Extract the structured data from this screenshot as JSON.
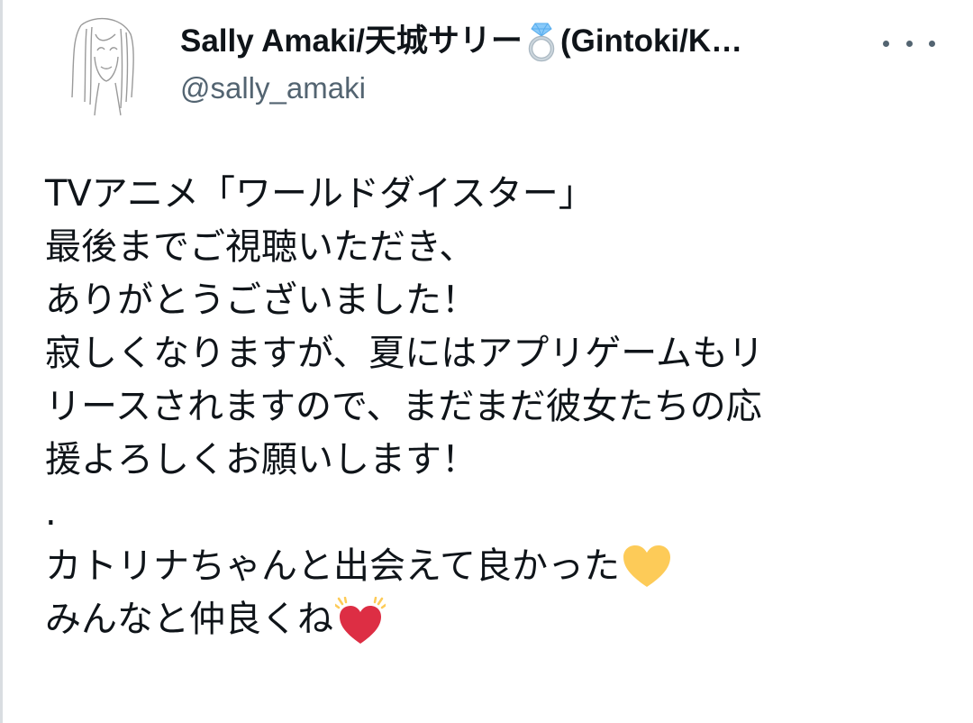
{
  "author": {
    "display_name_before": "Sally Amaki/天城サリー",
    "display_name_emoji": "ring-icon",
    "display_name_after": "(Gintoki/K…",
    "handle": "@sally_amaki"
  },
  "tweet": {
    "lines": [
      "TVアニメ「ワールドダイスター」",
      "最後までご視聴いただき、",
      "ありがとうございました！",
      "寂しくなりますが、夏にはアプリゲームもリ",
      "リースされますので、まだまだ彼女たちの応",
      "援よろしくお願いします！",
      ".",
      "カトリナちゃんと出会えて良かった",
      "みんなと仲良くね"
    ],
    "line8_emoji": "yellow-heart-icon",
    "line9_emoji": "beating-heart-icon"
  },
  "colors": {
    "text": "#0f1419",
    "secondary": "#536471",
    "yellow_heart": "#fdcb58",
    "red_heart": "#dd2e44"
  }
}
